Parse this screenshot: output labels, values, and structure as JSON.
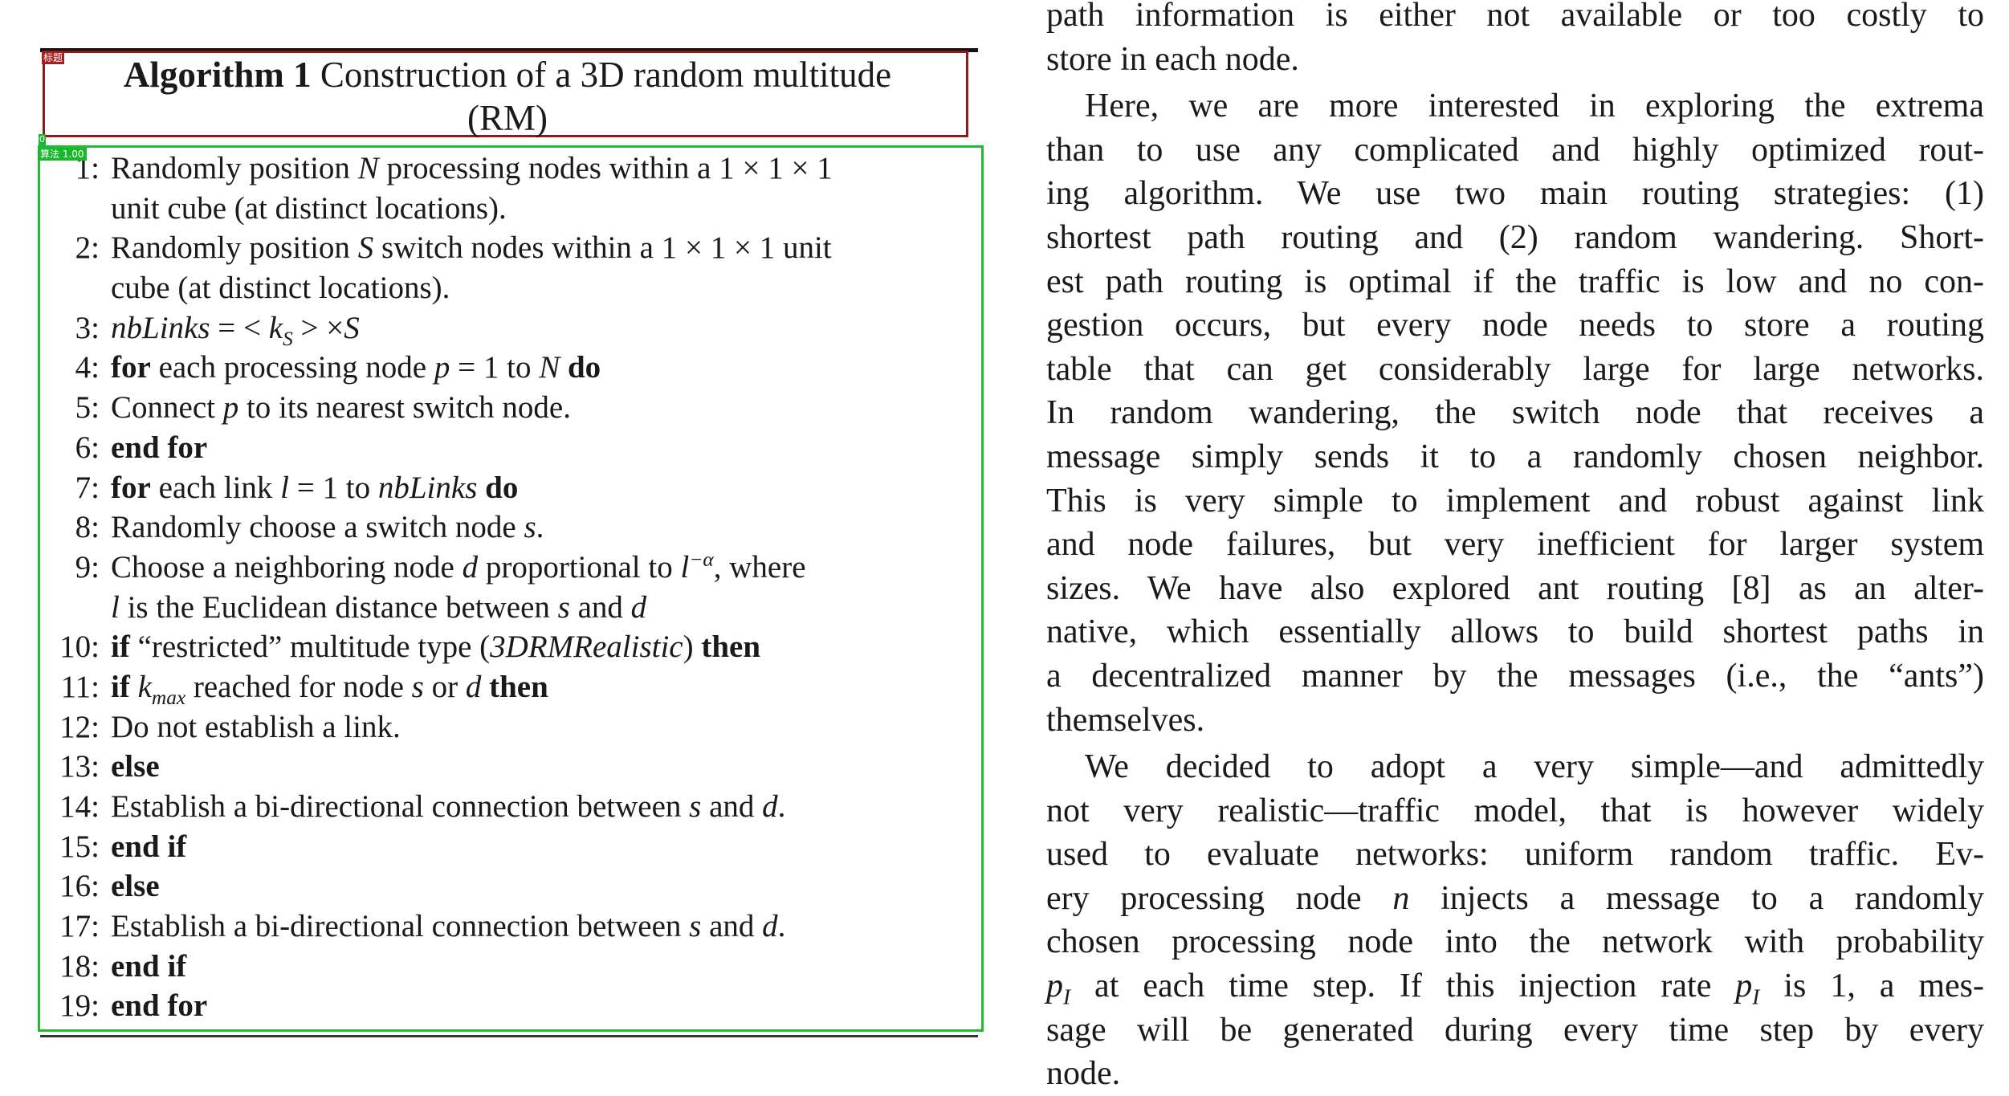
{
  "annotations": {
    "title_box_label": "标题",
    "algorithm_box_label": "算法 1.00",
    "algorithm_box_index": "0"
  },
  "algorithm": {
    "number_label": "Algorithm 1",
    "title_line1": "Construction of a 3D random multitude",
    "title_line2": "(RM)",
    "lines": [
      {
        "n": "1:",
        "parts": [
          [
            "t",
            "Randomly position "
          ],
          [
            "m",
            "N"
          ],
          [
            "t",
            " processing nodes within a 1 × 1 × 1"
          ]
        ]
      },
      {
        "n": "",
        "parts": [
          [
            "t",
            "unit cube (at distinct locations)."
          ]
        ]
      },
      {
        "n": "2:",
        "parts": [
          [
            "t",
            "Randomly position "
          ],
          [
            "m",
            "S"
          ],
          [
            "t",
            " switch nodes within a 1 × 1 × 1 unit"
          ]
        ]
      },
      {
        "n": "",
        "parts": [
          [
            "t",
            "cube (at distinct locations)."
          ]
        ]
      },
      {
        "n": "3:",
        "parts": [
          [
            "m",
            "nbLinks"
          ],
          [
            "t",
            " = < "
          ],
          [
            "m",
            "k"
          ],
          [
            "sub",
            "S"
          ],
          [
            "t",
            " > ×"
          ],
          [
            "m",
            "S"
          ]
        ]
      },
      {
        "n": "4:",
        "parts": [
          [
            "k",
            "for"
          ],
          [
            "t",
            " each processing node "
          ],
          [
            "m",
            "p"
          ],
          [
            "t",
            " = 1 to "
          ],
          [
            "m",
            "N"
          ],
          [
            "t",
            " "
          ],
          [
            "k",
            "do"
          ]
        ]
      },
      {
        "n": "5:",
        "parts": [
          [
            "t",
            "Connect "
          ],
          [
            "m",
            "p"
          ],
          [
            "t",
            " to its nearest switch node."
          ]
        ]
      },
      {
        "n": "6:",
        "parts": [
          [
            "k",
            "end for"
          ]
        ]
      },
      {
        "n": "7:",
        "parts": [
          [
            "k",
            "for"
          ],
          [
            "t",
            " each link "
          ],
          [
            "m",
            "l"
          ],
          [
            "t",
            " = 1 to "
          ],
          [
            "m",
            "nbLinks"
          ],
          [
            "t",
            " "
          ],
          [
            "k",
            "do"
          ]
        ]
      },
      {
        "n": "8:",
        "parts": [
          [
            "t",
            "Randomly choose a switch node "
          ],
          [
            "m",
            "s"
          ],
          [
            "t",
            "."
          ]
        ]
      },
      {
        "n": "9:",
        "parts": [
          [
            "t",
            "Choose a neighboring node "
          ],
          [
            "m",
            "d"
          ],
          [
            "t",
            " proportional to "
          ],
          [
            "m",
            "l"
          ],
          [
            "sup",
            "−α"
          ],
          [
            "t",
            ", where"
          ]
        ]
      },
      {
        "n": "",
        "parts": [
          [
            "m",
            "l"
          ],
          [
            "t",
            " is the Euclidean distance between "
          ],
          [
            "m",
            "s"
          ],
          [
            "t",
            " and "
          ],
          [
            "m",
            "d"
          ]
        ]
      },
      {
        "n": "10:",
        "parts": [
          [
            "k",
            "if"
          ],
          [
            "t",
            " “restricted” multitude type ("
          ],
          [
            "m",
            "3DRMRealistic"
          ],
          [
            "t",
            ") "
          ],
          [
            "k",
            "then"
          ]
        ]
      },
      {
        "n": "11:",
        "parts": [
          [
            "k",
            "if"
          ],
          [
            "t",
            " "
          ],
          [
            "m",
            "k"
          ],
          [
            "sub",
            "max"
          ],
          [
            "t",
            " reached for node "
          ],
          [
            "m",
            "s"
          ],
          [
            "t",
            " or "
          ],
          [
            "m",
            "d"
          ],
          [
            "t",
            " "
          ],
          [
            "k",
            "then"
          ]
        ]
      },
      {
        "n": "12:",
        "parts": [
          [
            "t",
            "Do not establish a link."
          ]
        ]
      },
      {
        "n": "13:",
        "parts": [
          [
            "k",
            "else"
          ]
        ]
      },
      {
        "n": "14:",
        "parts": [
          [
            "t",
            "Establish a bi-directional connection between "
          ],
          [
            "m",
            "s"
          ],
          [
            "t",
            " and "
          ],
          [
            "m",
            "d"
          ],
          [
            "t",
            "."
          ]
        ]
      },
      {
        "n": "15:",
        "parts": [
          [
            "k",
            "end if"
          ]
        ]
      },
      {
        "n": "16:",
        "parts": [
          [
            "k",
            "else"
          ]
        ]
      },
      {
        "n": "17:",
        "parts": [
          [
            "t",
            "Establish a bi-directional connection between "
          ],
          [
            "m",
            "s"
          ],
          [
            "t",
            " and "
          ],
          [
            "m",
            "d"
          ],
          [
            "t",
            "."
          ]
        ]
      },
      {
        "n": "18:",
        "parts": [
          [
            "k",
            "end if"
          ]
        ]
      },
      {
        "n": "19:",
        "parts": [
          [
            "k",
            "end for"
          ]
        ]
      }
    ]
  },
  "right_column": {
    "paragraphs": [
      {
        "indent": false,
        "lines": [
          "path information is either not available or too costly to",
          "store in each node."
        ]
      },
      {
        "indent": true,
        "lines": [
          "Here, we are more interested in exploring the extrema",
          "than to use any complicated and highly optimized rout-",
          "ing algorithm.  We use two main routing strategies: (1)",
          "shortest path routing and (2) random wandering. Short-",
          "est path routing is optimal if the traffic is low and no con-",
          "gestion occurs, but every node needs to store a routing",
          "table that can get considerably large for large networks.",
          "In random wandering, the switch node that receives a",
          "message simply sends it to a randomly chosen neighbor.",
          "This is very simple to implement and robust against link",
          "and node failures, but very inefficient for larger system",
          "sizes.  We have also explored ant routing [8] as an alter-",
          "native, which essentially allows to build shortest paths in",
          "a decentralized manner by the messages (i.e., the “ants”)",
          "themselves."
        ]
      },
      {
        "indent": true,
        "lines": [
          "We decided to adopt a very simple—and admittedly",
          "not very realistic—traffic model, that is however widely",
          "used to evaluate networks: uniform random traffic. Ev-",
          "ery processing node |n| injects a message to a randomly",
          "chosen processing node into the network with probability",
          "|p_I| at each time step. If this injection rate |p_I| is 1, a mes-",
          "sage will be generated during every time step by every",
          "node."
        ]
      }
    ]
  }
}
